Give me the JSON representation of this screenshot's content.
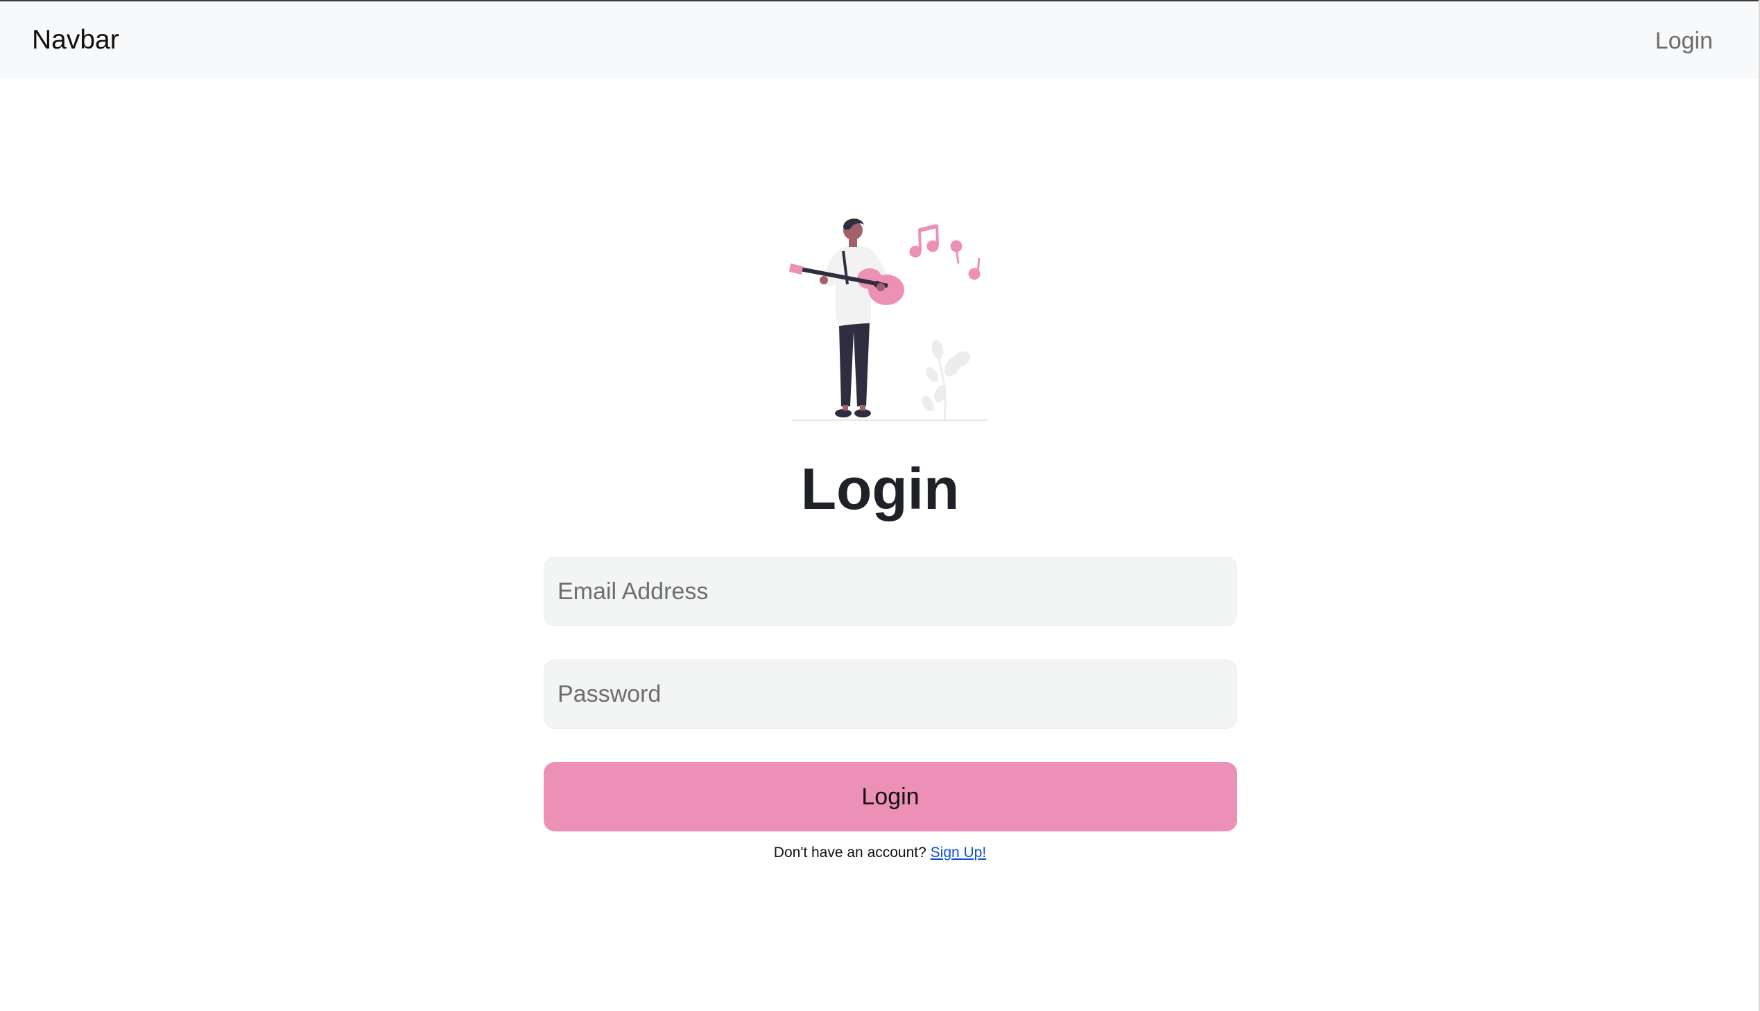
{
  "navbar": {
    "brand": "Navbar",
    "login_link": "Login"
  },
  "illustration": {
    "description_icon": "guitar-player-illustration"
  },
  "form": {
    "title": "Login",
    "email_placeholder": "Email Address",
    "password_placeholder": "Password",
    "submit_label": "Login",
    "signup_prompt": "Don't have an account? ",
    "signup_link": "Sign Up!"
  },
  "colors": {
    "accent": "#ec91b5",
    "navbar_bg": "#f8f9fa",
    "input_bg": "#f3f4f4",
    "link": "#0d4fd6"
  }
}
